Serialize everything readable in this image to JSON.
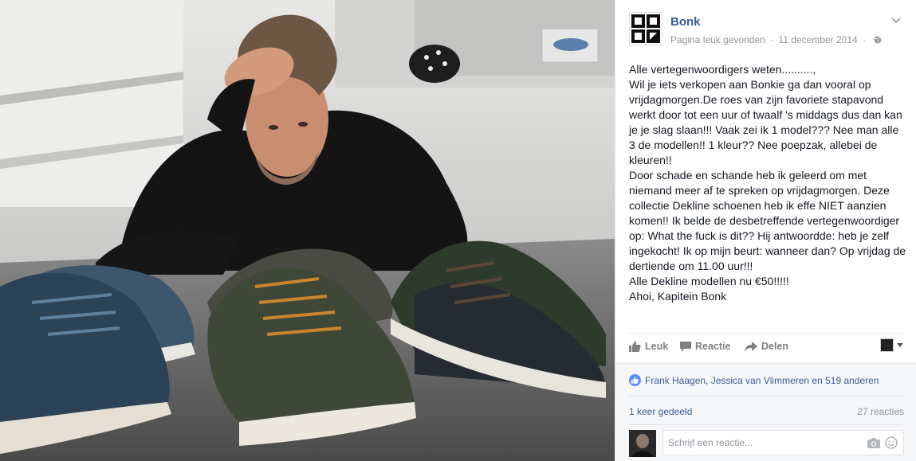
{
  "photo": {
    "alt_subject": "photo"
  },
  "post": {
    "page_name": "Bonk",
    "meta_action": "Pagina leuk gevonden",
    "meta_date": "11 december 2014",
    "audience_icon": "globe-icon",
    "menu_icon": "chevron-down-icon",
    "text_lines": [
      "Alle vertegenwoordigers weten..........,",
      "Wil je iets verkopen aan Bonkie ga dan vooral op vrijdagmorgen.De roes van zijn favoriete stapavond werkt door tot een uur of twaalf 's middags dus dan kan je je slag slaan!!! Vaak zei ik 1 model??? Nee man alle 3 de modellen!! 1 kleur?? Nee poepzak, allebei de kleuren!!",
      "Door schade en schande heb ik geleerd om met niemand meer af te spreken op vrijdagmorgen. Deze collectie Dekline schoenen heb ik effe NIET aanzien komen!! Ik belde de desbetreffende vertegenwoordiger op: What the fuck is dit?? Hij antwoordde: heb je zelf ingekocht! Ik op mijn beurt: wanneer dan? Op vrijdag de dertiende om 11.00 uur!!!",
      "Alle Dekline modellen nu €50!!!!!",
      "Ahoi, Kapitein Bonk"
    ]
  },
  "actions": {
    "like": "Leuk",
    "comment": "Reactie",
    "share": "Delen"
  },
  "ufi": {
    "likers": "Frank Haagen, Jessica van Vlimmeren en 519 anderen",
    "shares": "1 keer gedeeld",
    "comments_count": "27 reacties",
    "comment_placeholder": "Schrijf een reactie..."
  },
  "colors": {
    "link": "#3b5998",
    "meta": "#90949c",
    "like_badge": "#5890ff"
  }
}
